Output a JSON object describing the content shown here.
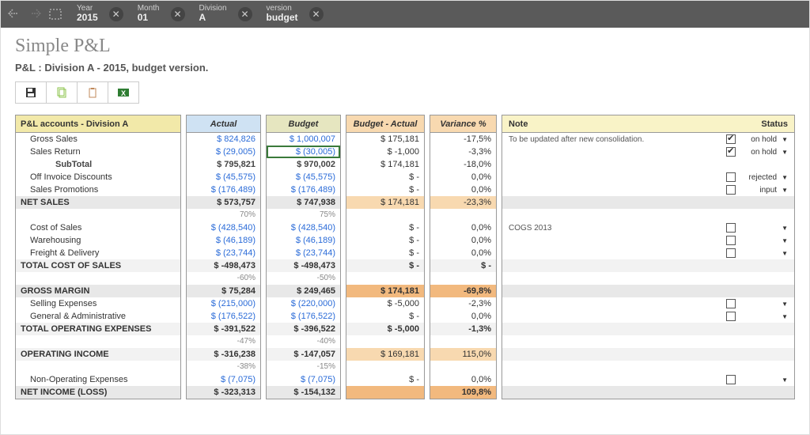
{
  "filters": [
    {
      "label": "Year",
      "value": "2015"
    },
    {
      "label": "Month",
      "value": "01"
    },
    {
      "label": "Division",
      "value": "A"
    },
    {
      "label": "version",
      "value": "budget"
    }
  ],
  "title": "Simple P&L",
  "subtitle": "P&L : Division A - 2015, budget version.",
  "headers": {
    "accounts": "P&L accounts - Division A",
    "actual": "Actual",
    "budget": "Budget",
    "diff": "Budget - Actual",
    "var": "Variance %",
    "note": "Note",
    "status": "Status"
  },
  "rows": [
    {
      "acc": "Gross Sales",
      "ind": 1,
      "actual": "$ 824,826",
      "budget": "$ 1,000,007",
      "diff": "$ 175,181",
      "var": "-17,5%",
      "note": "To be updated after new consolidation.",
      "chk": true,
      "status": "on hold",
      "dd": true
    },
    {
      "acc": "Sales Return",
      "ind": 1,
      "actual": "$ (29,005)",
      "budget": "$ (30,005)",
      "budget_sel": true,
      "diff": "$ -1,000",
      "var": "-3,3%",
      "note": "",
      "chk": true,
      "status": "on hold",
      "dd": true
    },
    {
      "acc": "SubTotal",
      "ind": 2,
      "bold": true,
      "actual": "$ 795,821",
      "budget": "$ 970,002",
      "diff": "$ 174,181",
      "var": "-18,0%",
      "note": "",
      "chk": null,
      "status": "",
      "dd": false
    },
    {
      "acc": "Off Invoice Discounts",
      "ind": 1,
      "actual": "$ (45,575)",
      "budget": "$ (45,575)",
      "diff": "$ -",
      "var": "0,0%",
      "note": "",
      "chk": false,
      "status": "rejected",
      "dd": true
    },
    {
      "acc": "Sales Promotions",
      "ind": 1,
      "actual": "$ (176,489)",
      "budget": "$ (176,489)",
      "diff": "$ -",
      "var": "0,0%",
      "note": "",
      "chk": false,
      "status": "input",
      "dd": true
    },
    {
      "acc": "NET SALES",
      "grey": true,
      "actual": "$ 573,757",
      "budget": "$ 747,938",
      "diff": "$ 174,181",
      "var": "-23,3%",
      "difflight": true,
      "note": "",
      "chk": null,
      "status": "",
      "dd": false
    },
    {
      "acc": "",
      "small": true,
      "actual": "70%",
      "budget": "75%",
      "diff": "",
      "var": "",
      "note": "",
      "chk": null,
      "status": "",
      "dd": false
    },
    {
      "acc": "Cost of Sales",
      "ind": 1,
      "actual": "$ (428,540)",
      "budget": "$ (428,540)",
      "diff": "$ -",
      "var": "0,0%",
      "note": "COGS 2013",
      "chk": false,
      "status": "",
      "dd": true
    },
    {
      "acc": "Warehousing",
      "ind": 1,
      "actual": "$ (46,189)",
      "budget": "$ (46,189)",
      "diff": "$ -",
      "var": "0,0%",
      "note": "",
      "chk": false,
      "status": "",
      "dd": true
    },
    {
      "acc": "Freight & Delivery",
      "ind": 1,
      "actual": "$ (23,744)",
      "budget": "$ (23,744)",
      "diff": "$ -",
      "var": "0,0%",
      "note": "",
      "chk": false,
      "status": "",
      "dd": true
    },
    {
      "acc": "TOTAL COST OF SALES",
      "lgrey": true,
      "actual": "$ -498,473",
      "budget": "$ -498,473",
      "diff": "$ -",
      "var": "$ -",
      "note": "",
      "chk": null,
      "status": "",
      "dd": false
    },
    {
      "acc": "",
      "small": true,
      "actual": "-60%",
      "budget": "-50%",
      "diff": "",
      "var": "",
      "note": "",
      "chk": null,
      "status": "",
      "dd": false
    },
    {
      "acc": "GROSS MARGIN",
      "grey": true,
      "actual": "$ 75,284",
      "budget": "$ 249,465",
      "diff": "$ 174,181",
      "var": "-69,8%",
      "diffdark": true,
      "note": "",
      "chk": null,
      "status": "",
      "dd": false
    },
    {
      "acc": "Selling Expenses",
      "ind": 1,
      "actual": "$ (215,000)",
      "budget": "$ (220,000)",
      "diff": "$ -5,000",
      "var": "-2,3%",
      "note": "",
      "chk": false,
      "status": "",
      "dd": true
    },
    {
      "acc": "General & Administrative",
      "ind": 1,
      "actual": "$ (176,522)",
      "budget": "$ (176,522)",
      "diff": "$ -",
      "var": "0,0%",
      "note": "",
      "chk": false,
      "status": "",
      "dd": true
    },
    {
      "acc": "TOTAL OPERATING EXPENSES",
      "lgrey": true,
      "actual": "$ -391,522",
      "budget": "$ -396,522",
      "diff": "$ -5,000",
      "var": "-1,3%",
      "note": "",
      "chk": null,
      "status": "",
      "dd": false
    },
    {
      "acc": "",
      "small": true,
      "actual": "-47%",
      "budget": "-40%",
      "diff": "",
      "var": "",
      "note": "",
      "chk": null,
      "status": "",
      "dd": false
    },
    {
      "acc": "OPERATING INCOME",
      "lgrey": true,
      "actual": "$ -316,238",
      "budget": "$ -147,057",
      "diff": "$ 169,181",
      "var": "115,0%",
      "difflight": true,
      "note": "",
      "chk": null,
      "status": "",
      "dd": false
    },
    {
      "acc": "",
      "small": true,
      "actual": "-38%",
      "budget": "-15%",
      "diff": "",
      "var": "",
      "note": "",
      "chk": null,
      "status": "",
      "dd": false
    },
    {
      "acc": "Non-Operating Expenses",
      "ind": 1,
      "actual": "$ (7,075)",
      "budget": "$ (7,075)",
      "diff": "$ -",
      "var": "0,0%",
      "note": "",
      "chk": false,
      "status": "",
      "dd": true
    },
    {
      "acc": "NET INCOME (LOSS)",
      "grey": true,
      "actual": "$ -323,313",
      "budget": "$ -154,132",
      "diff": "",
      "var": "109,8%",
      "diffdark": true,
      "note": "",
      "chk": null,
      "status": "",
      "dd": false
    }
  ]
}
